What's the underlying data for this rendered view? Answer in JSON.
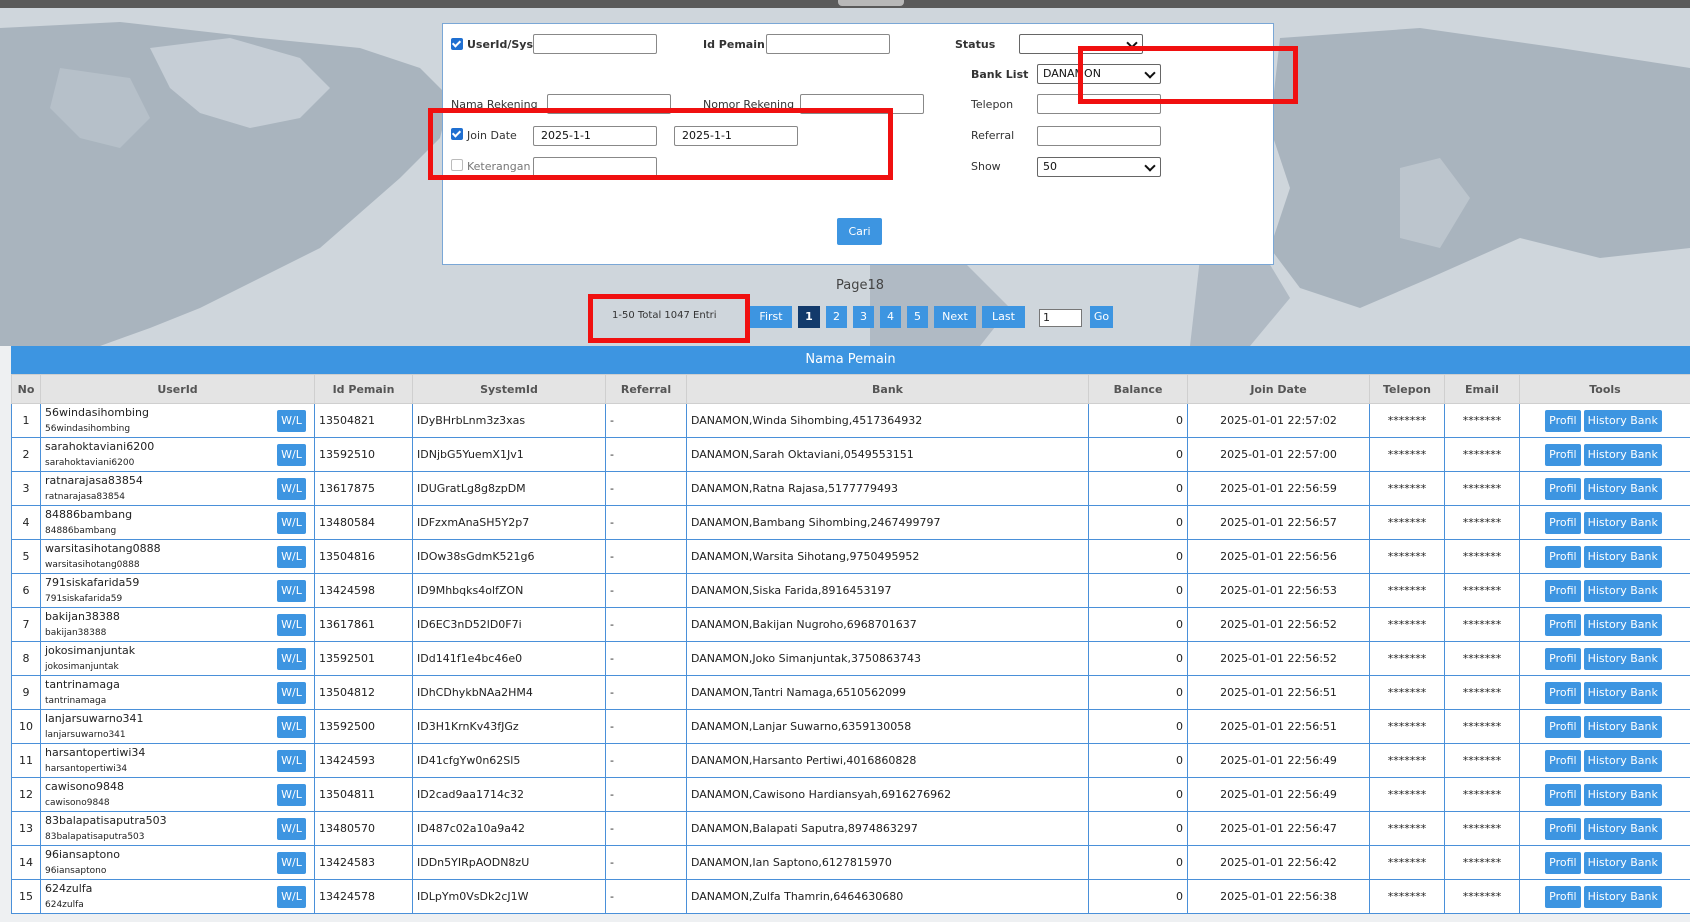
{
  "filters": {
    "userid_label": "UserId/SystemId",
    "userid_value": "",
    "idpemain_label": "Id Pemain",
    "idpemain_value": "",
    "status_label": "Status",
    "status_value": "",
    "banklist_label": "Bank List",
    "banklist_value": "DANAMON",
    "nama_rekening_label": "Nama Rekening",
    "nama_rekening_value": "",
    "nomor_rekening_label": "Nomor Rekening",
    "nomor_rekening_value": "",
    "telepon_label": "Telepon",
    "telepon_value": "",
    "joindate_label": "Join Date",
    "joindate_from": "2025-1-1",
    "joindate_to": "2025-1-1",
    "referral_label": "Referral",
    "referral_value": "",
    "keterangan_label": "Keterangan",
    "keterangan_value": "",
    "show_label": "Show",
    "show_value": "50",
    "search_button": "Cari"
  },
  "pagination": {
    "page_label": "Page18",
    "total_label": "1-50 Total 1047 Entri",
    "first": "First",
    "pages": [
      "1",
      "2",
      "3",
      "4",
      "5"
    ],
    "active_page": "1",
    "next": "Next",
    "last": "Last",
    "goto_value": "1",
    "go": "Go"
  },
  "table": {
    "title": "Nama Pemain",
    "headers": [
      "No",
      "UserId",
      "Id Pemain",
      "SystemId",
      "Referral",
      "Bank",
      "Balance",
      "Join Date",
      "Telepon",
      "Email",
      "Tools"
    ],
    "wl_label": "W/L",
    "profil_label": "Profil",
    "history_label": "History Bank",
    "rows": [
      {
        "no": "1",
        "user": "56windasihombing",
        "sub": "56windasihombing",
        "idp": "13504821",
        "sys": "IDyBHrbLnm3z3xas",
        "ref": "-",
        "bank": "DANAMON,Winda Sihombing,4517364932",
        "bal": "0",
        "join": "2025-01-01 22:57:02",
        "tel": "*******",
        "email": "*******"
      },
      {
        "no": "2",
        "user": "sarahoktaviani6200",
        "sub": "sarahoktaviani6200",
        "idp": "13592510",
        "sys": "IDNjbG5YuemX1Jv1",
        "ref": "-",
        "bank": "DANAMON,Sarah Oktaviani,0549553151",
        "bal": "0",
        "join": "2025-01-01 22:57:00",
        "tel": "*******",
        "email": "*******"
      },
      {
        "no": "3",
        "user": "ratnarajasa83854",
        "sub": "ratnarajasa83854",
        "idp": "13617875",
        "sys": "IDUGratLg8g8zpDM",
        "ref": "-",
        "bank": "DANAMON,Ratna Rajasa,5177779493",
        "bal": "0",
        "join": "2025-01-01 22:56:59",
        "tel": "*******",
        "email": "*******"
      },
      {
        "no": "4",
        "user": "84886bambang",
        "sub": "84886bambang",
        "idp": "13480584",
        "sys": "IDFzxmAnaSH5Y2p7",
        "ref": "-",
        "bank": "DANAMON,Bambang Sihombing,2467499797",
        "bal": "0",
        "join": "2025-01-01 22:56:57",
        "tel": "*******",
        "email": "*******"
      },
      {
        "no": "5",
        "user": "warsitasihotang0888",
        "sub": "warsitasihotang0888",
        "idp": "13504816",
        "sys": "IDOw38sGdmK521g6",
        "ref": "-",
        "bank": "DANAMON,Warsita Sihotang,9750495952",
        "bal": "0",
        "join": "2025-01-01 22:56:56",
        "tel": "*******",
        "email": "*******"
      },
      {
        "no": "6",
        "user": "791siskafarida59",
        "sub": "791siskafarida59",
        "idp": "13424598",
        "sys": "ID9Mhbqks4olfZON",
        "ref": "-",
        "bank": "DANAMON,Siska Farida,8916453197",
        "bal": "0",
        "join": "2025-01-01 22:56:53",
        "tel": "*******",
        "email": "*******"
      },
      {
        "no": "7",
        "user": "bakijan38388",
        "sub": "bakijan38388",
        "idp": "13617861",
        "sys": "ID6EC3nD52lD0F7i",
        "ref": "-",
        "bank": "DANAMON,Bakijan Nugroho,6968701637",
        "bal": "0",
        "join": "2025-01-01 22:56:52",
        "tel": "*******",
        "email": "*******"
      },
      {
        "no": "8",
        "user": "jokosimanjuntak",
        "sub": "jokosimanjuntak",
        "idp": "13592501",
        "sys": "IDd141f1e4bc46e0",
        "ref": "-",
        "bank": "DANAMON,Joko Simanjuntak,3750863743",
        "bal": "0",
        "join": "2025-01-01 22:56:52",
        "tel": "*******",
        "email": "*******"
      },
      {
        "no": "9",
        "user": "tantrinamaga",
        "sub": "tantrinamaga",
        "idp": "13504812",
        "sys": "IDhCDhykbNAa2HM4",
        "ref": "-",
        "bank": "DANAMON,Tantri Namaga,6510562099",
        "bal": "0",
        "join": "2025-01-01 22:56:51",
        "tel": "*******",
        "email": "*******"
      },
      {
        "no": "10",
        "user": "lanjarsuwarno341",
        "sub": "lanjarsuwarno341",
        "idp": "13592500",
        "sys": "ID3H1KrnKv43fJGz",
        "ref": "-",
        "bank": "DANAMON,Lanjar Suwarno,6359130058",
        "bal": "0",
        "join": "2025-01-01 22:56:51",
        "tel": "*******",
        "email": "*******"
      },
      {
        "no": "11",
        "user": "harsantopertiwi34",
        "sub": "harsantopertiwi34",
        "idp": "13424593",
        "sys": "ID41cfgYw0n62Sl5",
        "ref": "-",
        "bank": "DANAMON,Harsanto Pertiwi,4016860828",
        "bal": "0",
        "join": "2025-01-01 22:56:49",
        "tel": "*******",
        "email": "*******"
      },
      {
        "no": "12",
        "user": "cawisono9848",
        "sub": "cawisono9848",
        "idp": "13504811",
        "sys": "ID2cad9aa1714c32",
        "ref": "-",
        "bank": "DANAMON,Cawisono Hardiansyah,6916276962",
        "bal": "0",
        "join": "2025-01-01 22:56:49",
        "tel": "*******",
        "email": "*******"
      },
      {
        "no": "13",
        "user": "83balapatisaputra503",
        "sub": "83balapatisaputra503",
        "idp": "13480570",
        "sys": "ID487c02a10a9a42",
        "ref": "-",
        "bank": "DANAMON,Balapati Saputra,8974863297",
        "bal": "0",
        "join": "2025-01-01 22:56:47",
        "tel": "*******",
        "email": "*******"
      },
      {
        "no": "14",
        "user": "96iansaptono",
        "sub": "96iansaptono",
        "idp": "13424583",
        "sys": "IDDn5YIRpAODN8zU",
        "ref": "-",
        "bank": "DANAMON,Ian Saptono,6127815970",
        "bal": "0",
        "join": "2025-01-01 22:56:42",
        "tel": "*******",
        "email": "*******"
      },
      {
        "no": "15",
        "user": "624zulfa",
        "sub": "624zulfa",
        "idp": "13424578",
        "sys": "IDLpYm0VsDk2cJ1W",
        "ref": "-",
        "bank": "DANAMON,Zulfa Thamrin,6464630680",
        "bal": "0",
        "join": "2025-01-01 22:56:38",
        "tel": "*******",
        "email": "*******"
      }
    ]
  }
}
